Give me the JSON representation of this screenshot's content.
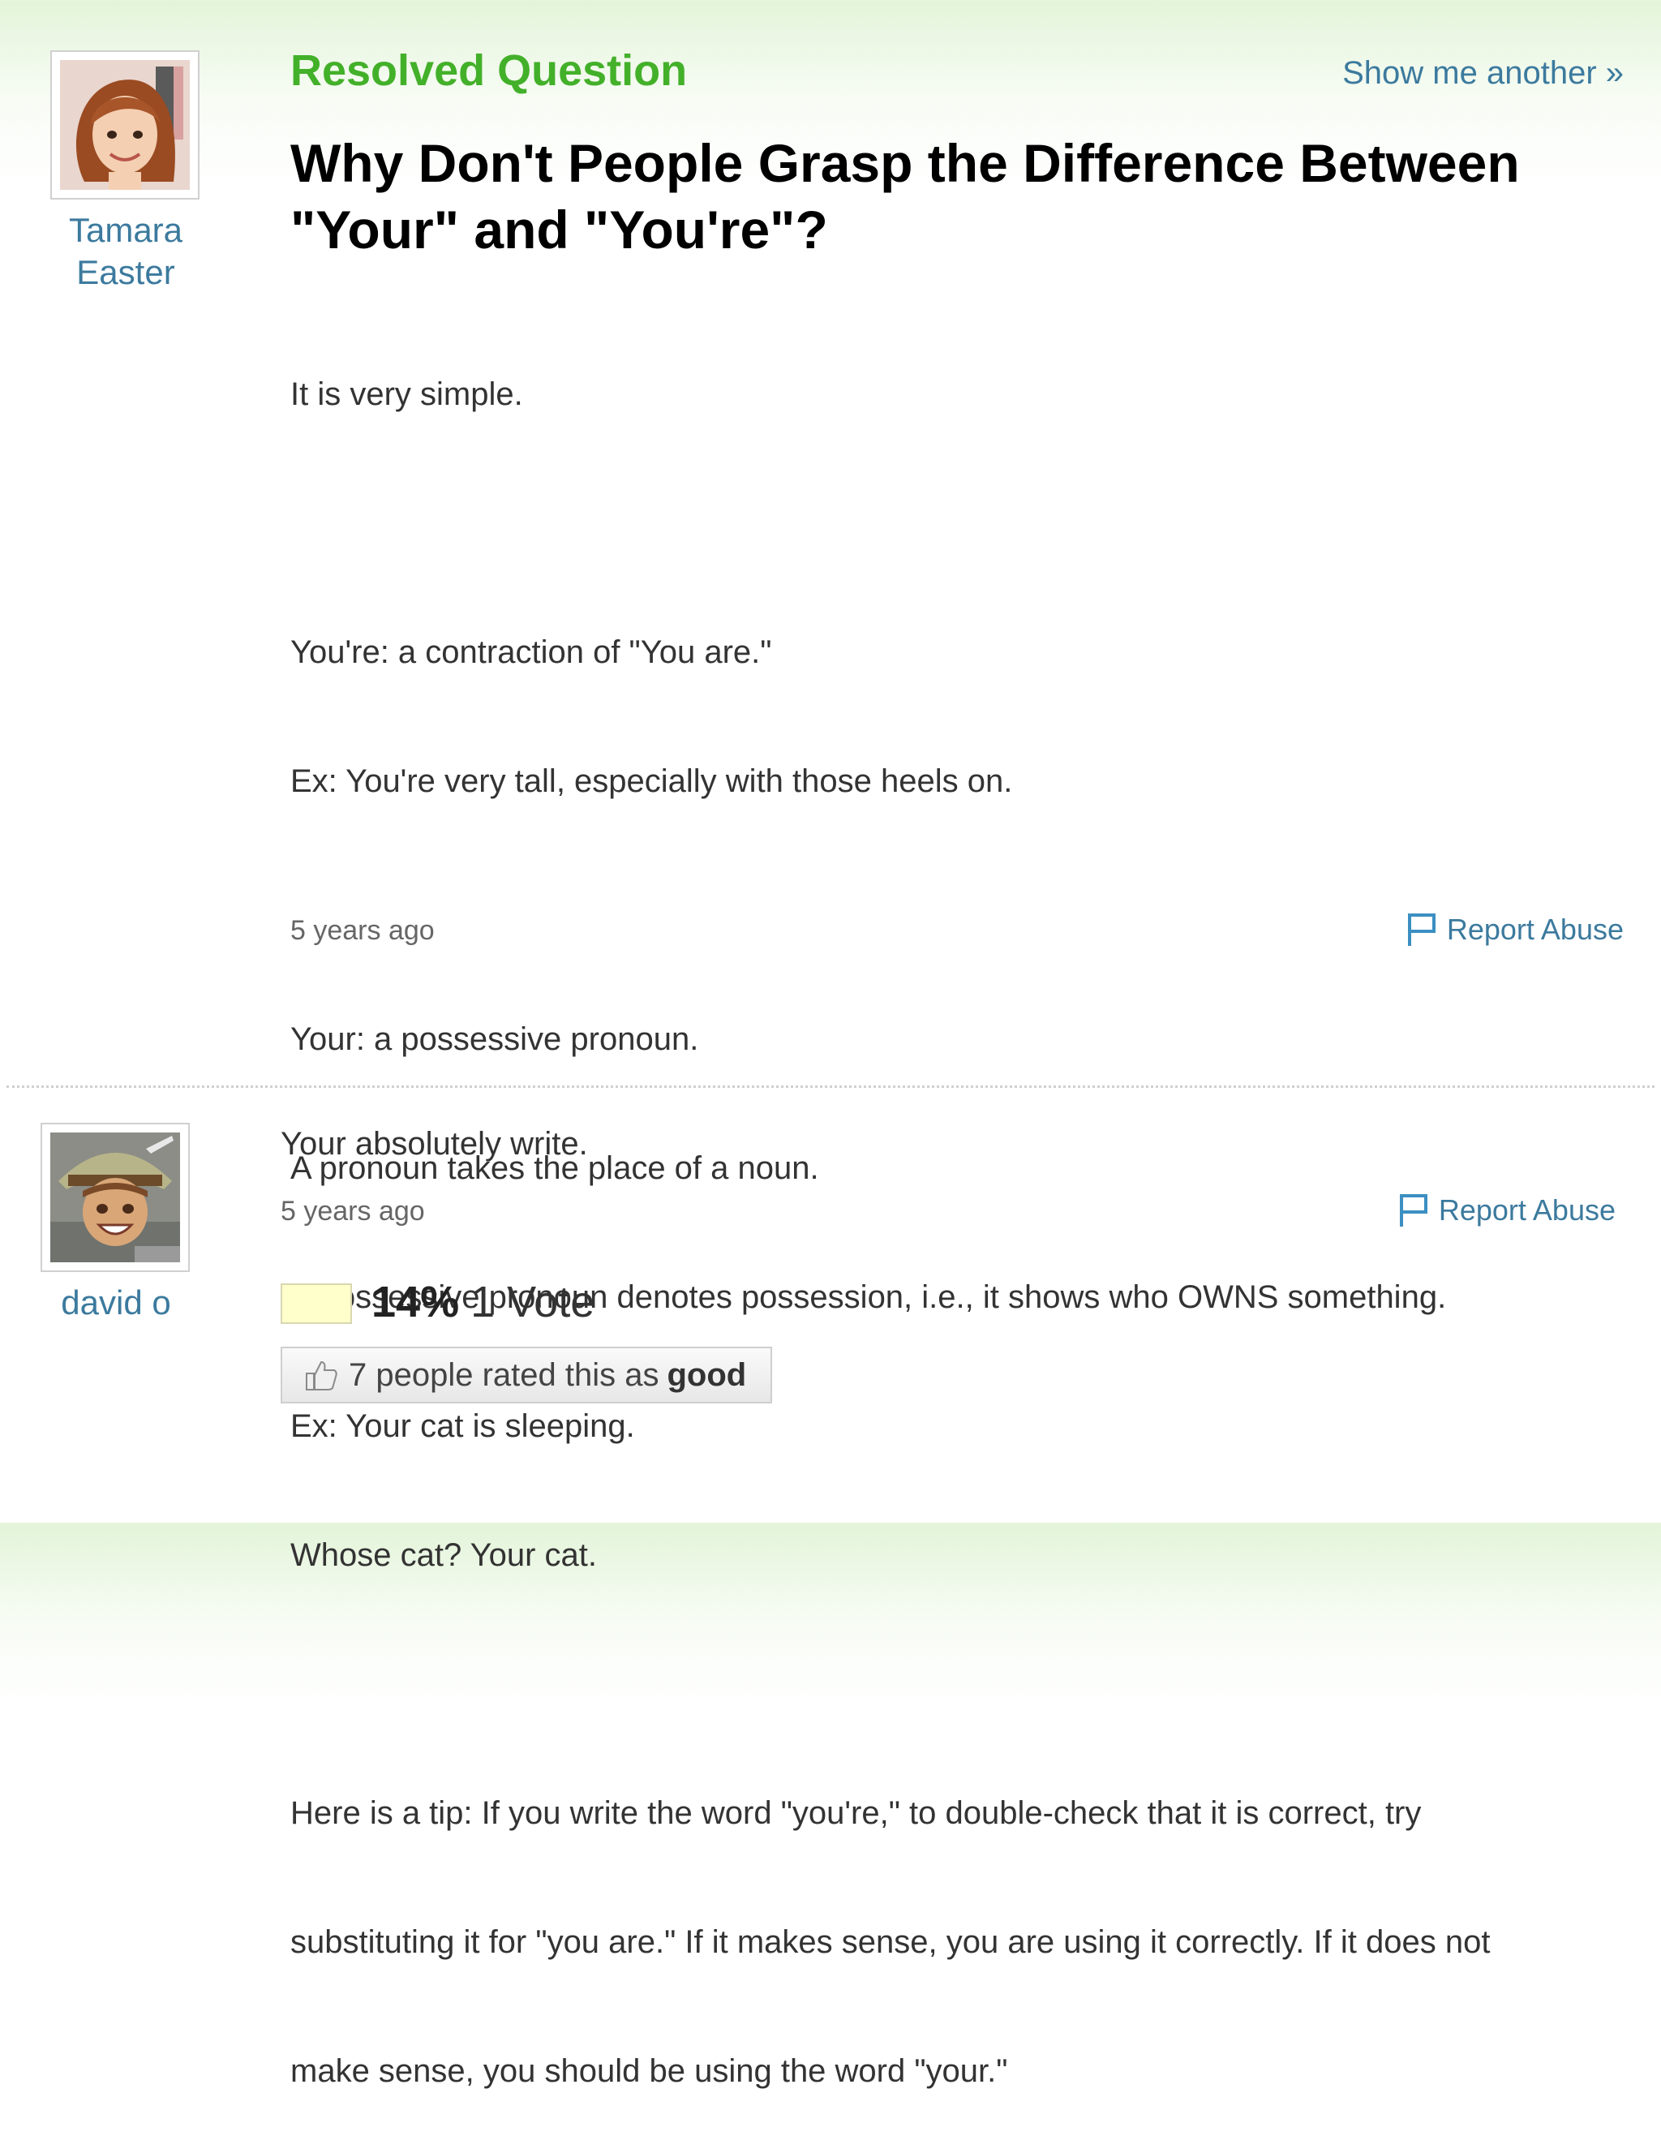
{
  "question": {
    "status_label": "Resolved Question",
    "show_another_label": "Show me another »",
    "asker_first_name": "Tamara",
    "asker_last_name": "Easter",
    "title_line1": "Why Don't People Grasp the Difference Between",
    "title_line2": "\"Your\" and \"You're\"?",
    "body": {
      "line01": "It is very simple.",
      "line02": "You're: a contraction of \"You are.\"",
      "line03": "Ex: You're very tall, especially with those heels on.",
      "line04": "Your: a possessive pronoun.",
      "line05": "A pronoun takes the place of a noun.",
      "line06": "A possessive pronoun denotes possession, i.e., it shows who OWNS something.",
      "line07": "Ex: Your cat is sleeping.",
      "line08": "Whose cat? Your cat.",
      "line09": "Here is a tip: If you write the word \"you're,\" to double-check that it is correct, try",
      "line10": "substituting it for \"you are.\" If it makes sense, you are using it correctly. If it does not",
      "line11": "make sense, you should be using the word \"your.\""
    },
    "timestamp": "5 years ago",
    "report_label": "Report Abuse"
  },
  "answer": {
    "author_name": "david o",
    "text": "Your absolutely write.",
    "timestamp": "5 years ago",
    "report_label": "Report Abuse",
    "vote_percent": "14%",
    "vote_count_label": "1 Vote",
    "vote_fraction": 0.14,
    "rated_prefix": "7 people rated this as",
    "rated_word": "good"
  },
  "colors": {
    "resolved_green": "#43b02a",
    "link_blue": "#3c7a9e",
    "vote_fill": "#ffffcc",
    "header_gradient_top": "#e3f4d9"
  },
  "icons": {
    "flag": "flag-icon",
    "thumb": "thumbs-up-icon",
    "asker_avatar": "avatar-woman",
    "answerer_avatar": "avatar-man-hat"
  }
}
